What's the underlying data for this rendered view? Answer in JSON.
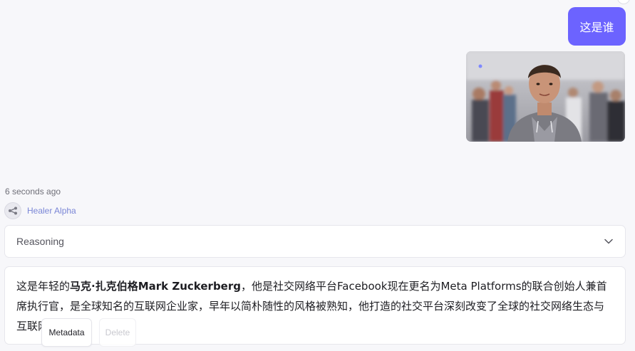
{
  "user_message": {
    "text": "这是谁",
    "image_alt": "user-uploaded-photo"
  },
  "assistant": {
    "timestamp": "6 seconds ago",
    "model_name": "Healer Alpha",
    "reasoning_label": "Reasoning",
    "answer": {
      "prefix": "这是年轻的",
      "name_bold": "马克·扎克伯格Mark Zuckerberg",
      "suffix": "，他是社交网络平台Facebook现在更名为Meta Platforms的联合创始人兼首席执行官，是全球知名的互联网企业家，早年以简朴随性的风格被熟知，他打造的社交平台深刻改变了全球的社交网络生态与互联网格局。"
    },
    "actions": {
      "metadata_label": "Metadata",
      "delete_label": "Delete"
    }
  },
  "colors": {
    "accent": "#6c63ff",
    "model_name": "#7a86d6",
    "page_bg": "#f7f7fa"
  }
}
